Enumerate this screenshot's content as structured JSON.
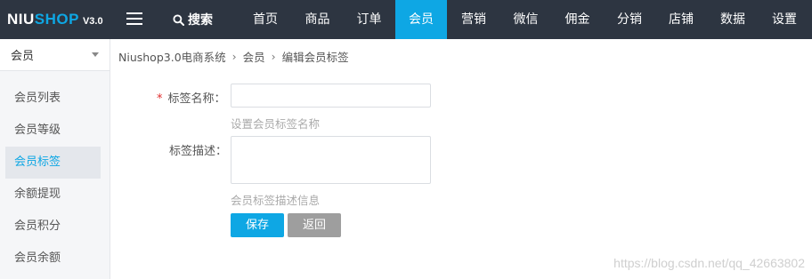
{
  "logo": {
    "brand_main": "NIU",
    "brand_accent": "SHOP",
    "version": "V3.0"
  },
  "header": {
    "search_label": "搜索",
    "nav": [
      {
        "label": "首页",
        "active": false
      },
      {
        "label": "商品",
        "active": false
      },
      {
        "label": "订单",
        "active": false
      },
      {
        "label": "会员",
        "active": true
      },
      {
        "label": "营销",
        "active": false
      },
      {
        "label": "微信",
        "active": false
      },
      {
        "label": "佣金",
        "active": false
      },
      {
        "label": "分销",
        "active": false
      },
      {
        "label": "店铺",
        "active": false
      },
      {
        "label": "数据",
        "active": false
      },
      {
        "label": "设置",
        "active": false
      }
    ]
  },
  "sidebar": {
    "header": "会员",
    "items": [
      {
        "label": "会员列表",
        "active": false
      },
      {
        "label": "会员等级",
        "active": false
      },
      {
        "label": "会员标签",
        "active": true
      },
      {
        "label": "余额提现",
        "active": false
      },
      {
        "label": "会员积分",
        "active": false
      },
      {
        "label": "会员余额",
        "active": false
      }
    ]
  },
  "breadcrumb": [
    "Niushop3.0电商系统",
    "会员",
    "编辑会员标签"
  ],
  "form": {
    "name_required": "*",
    "name_label": "标签名称：",
    "name_value": "",
    "name_hint": "设置会员标签名称",
    "desc_label": "标签描述：",
    "desc_value": "",
    "desc_hint": "会员标签描述信息",
    "save_label": "保存",
    "back_label": "返回"
  },
  "watermark": "https://blog.csdn.net/qq_42663802",
  "colors": {
    "topbar": "#2d3541",
    "accent": "#0ea7e4",
    "required": "#e02d2d",
    "back_button": "#9e9e9e"
  }
}
